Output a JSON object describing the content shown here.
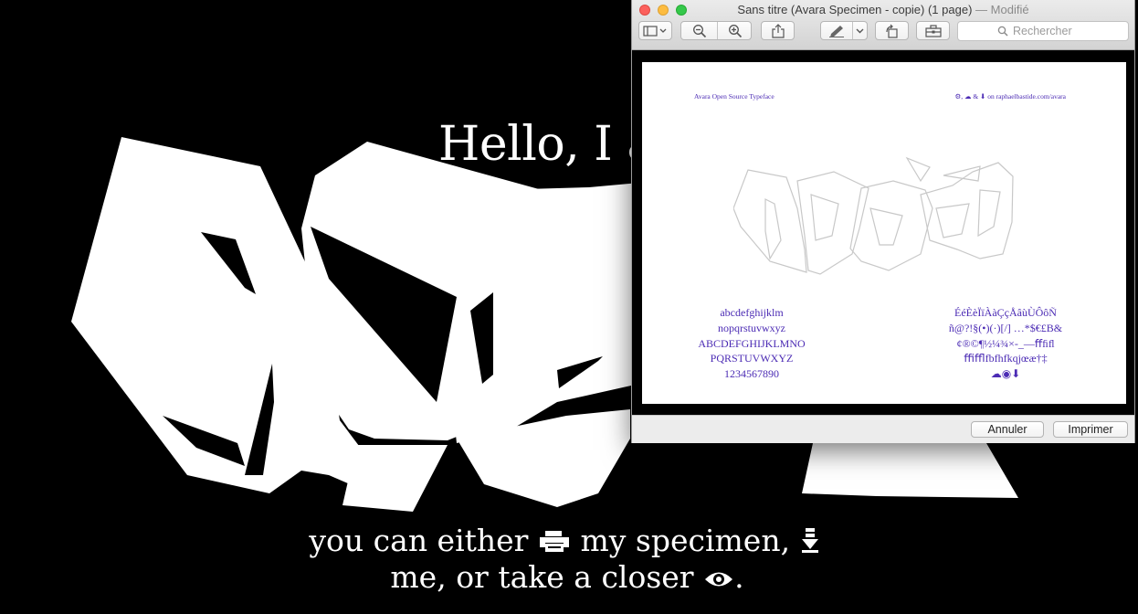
{
  "website": {
    "heading": "Hello, I a",
    "tagline_line1_before": "you can either",
    "tagline_line1_after": "my specimen,",
    "tagline_line2_before": "me, or take a closer",
    "tagline_line2_after": ".",
    "print_icon": "printer-icon",
    "download_icon": "download-arrow-icon",
    "look_icon": "eye-icon"
  },
  "window": {
    "title": "Sans titre (Avara Specimen - copie) (1 page)",
    "separator": "—",
    "status": "Modifié",
    "controls": [
      "close-button",
      "minimize-button",
      "zoom-button"
    ]
  },
  "toolbar": {
    "buttons": [
      "sidebar-toggle-icon",
      "zoom-out-icon",
      "zoom-in-icon",
      "share-icon",
      "markup-pen-icon",
      "rotate-icon",
      "toolbox-icon"
    ],
    "search_placeholder": "Rechercher"
  },
  "preview": {
    "header_left": "Avara Open Source Typeface",
    "header_right": "⚙, ☁ & ⬇ on raphaelbastide.com/avara",
    "left_lines": [
      "abcdefghijklm",
      "nopqrstuvwxyz",
      "ABCDEFGHIJKLMNO",
      "PQRSTUVWXYZ",
      "1234567890"
    ],
    "right_lines": [
      "ÉéÈèÏïÀàÇçÅâùÙÔôÑ",
      "ñ@?!§(•)(·)[/] …*$€£B&",
      "¢®©¶½¼¾×-_—ﬀﬁﬂ",
      "ﬃﬄfbfhfkqjœæ†‡",
      "☁◉⬇"
    ]
  },
  "footer": {
    "cancel_label": "Annuler",
    "print_label": "Imprimer"
  },
  "colors": {
    "preview_text": "#4b2bb4",
    "accent_close": "#fc605c",
    "accent_minimize": "#fdbc40",
    "accent_zoom": "#34c84a"
  }
}
